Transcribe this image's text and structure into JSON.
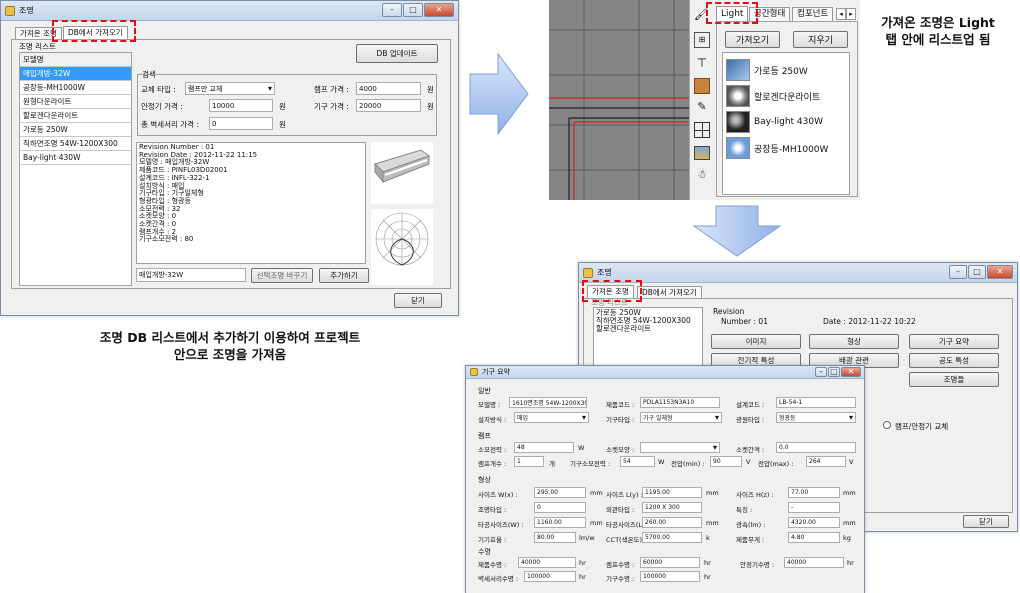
{
  "win1": {
    "title": "조명",
    "tabs": [
      "가져온 조명",
      "DB에서 가져오기"
    ],
    "group_label": "조명 리스트",
    "db_update": "DB 업데이트",
    "list_header": "모델명",
    "list_items": [
      "매입개방-32W",
      "공장등-MH1000W",
      "원형다운라이트",
      "할로겐다운라이트",
      "가로등 250W",
      "직하면조명 54W-1200X300",
      "Bay-light 430W"
    ],
    "search_group": "검색",
    "f_type_label": "교체 타입 :",
    "f_type_value": "램프만 교체",
    "f_lamp_label": "램프 가격 :",
    "f_lamp_value": "4000",
    "unit_won": "원",
    "f_stable_label": "안정기 가격 :",
    "f_stable_value": "10000",
    "f_fixture_label": "기구 가격 :",
    "f_fixture_value": "20000",
    "f_total_label": "총 벽세서리 가격 :",
    "f_total_value": "0",
    "info_lines": [
      "Revision Number : 01",
      "Revision Date : 2012-11-22 11:15",
      "모델명 : 매입개방-32W",
      "제품코드 : PINFL03D02001",
      "설계코드 : INFL-322-1",
      "설치방식 : 매입",
      "기구타입 : 기구일체형",
      "형광타입 : 형광등",
      "소모전력 : 32",
      "소켓모양 : 0",
      "소켓간격 : 0",
      "램프개수 : 2",
      "기구소모전력 : 80"
    ],
    "name_input": "매입개방-32W",
    "btn_change": "선택조명 바꾸기",
    "btn_add": "추가하기",
    "btn_close": "닫기"
  },
  "win2": {
    "tabs": [
      "Light",
      "공간형태",
      "컴포넌트"
    ],
    "btn_fetch": "가져오기",
    "btn_clear": "지우기",
    "items": [
      "가로등 250W",
      "할로겐다운라이트",
      "Bay-light 430W",
      "공장등-MH1000W"
    ]
  },
  "win3": {
    "title": "조명",
    "tabs": [
      "가져온 조명",
      "DB에서 가져오기"
    ],
    "group_label": "조명 리스트",
    "list_items": [
      "가로등 250W",
      "직하면조명 54W-1200X300",
      "할로겐다운라이트"
    ],
    "revision_label": "Revision",
    "number_text": "Number :  01",
    "date_text": "Date :  2012-11-22 10:22",
    "btns": [
      "이미지",
      "형상",
      "기구 요약",
      "전기적 특성",
      "배광 관련",
      "공도 특성"
    ],
    "btn_light": "조명들",
    "radio_label": "램프/안정기 교체",
    "btn_close": "닫기"
  },
  "win4": {
    "title": "기구 요약",
    "sec_general": "일반",
    "model_label": "모델명 :",
    "model_value": "1610면조명 54W-1200X300",
    "code_label": "제품코드 :",
    "code_value": "PDLA1153N3A10",
    "design_label": "설계코드 :",
    "design_value": "LB-54-1",
    "install_label": "설치방식 :",
    "install_value": "매입",
    "ftype_label": "기구타입 :",
    "ftype_value": "기구 일체형",
    "light_label": "광원타입 :",
    "light_value": "형광등",
    "sec_lamp": "램프",
    "power_label": "소모전력 :",
    "power_value": "48",
    "unit_w": "W",
    "socket_label": "소켓모양 :",
    "socket_value": "",
    "gap_label": "소켓간격 :",
    "gap_value": "0.0",
    "count_label": "램프개수 :",
    "count_value": "1",
    "unit_ea": "개",
    "fpower_label": "기구소모전력 :",
    "fpower_value": "54",
    "vmin_label": "전압(min) :",
    "vmin_value": "90",
    "unit_v": "V",
    "vmax_label": "전압(max) :",
    "vmax_value": "264",
    "sec_shape": "형상",
    "sx_label": "사이즈 W(x) :",
    "sx_value": "295.00",
    "unit_mm": "mm",
    "sy_label": "사이즈 L(y) :",
    "sy_value": "1195.00",
    "sz_label": "사이즈 H(z) :",
    "sz_value": "77.00",
    "shape_label": "조명타입 :",
    "shape_value": "0",
    "outer_label": "외관타입 :",
    "outer_value": "1200 X 300",
    "feat_label": "특징 :",
    "feat_value": "-",
    "hw_label": "타공사이즈(W) :",
    "hw_value": "1160.00",
    "hl_label": "타공사이즈(L) :",
    "hl_value": "260.00",
    "beam_label": "광속(lm) :",
    "beam_value": "4320.00",
    "eff_label": "기기효율 :",
    "eff_value": "80.00",
    "unit_eff": "lm/w",
    "cct_label": "CCT(색온도) :",
    "cct_value": "5700.00",
    "unit_k": "k",
    "weight_label": "제품무게 :",
    "weight_value": "4.80",
    "unit_kg": "kg",
    "sec_life": "수명",
    "life_label": "제품수명 :",
    "life_value": "40000",
    "unit_hr": "hr",
    "llife_label": "램프수명 :",
    "llife_value": "60000",
    "slife_label": "안정기수명 :",
    "slife_value": "40000",
    "alife_label": "벽세서리수명 :",
    "alife_value": "100000",
    "flife_label": "기구수명 :",
    "flife_value": "100000"
  },
  "notes": {
    "left": [
      "조명 DB 리스트에서 추가하기 이용하여 프로젝트",
      "안으로 조명을 가져옴"
    ],
    "right": [
      "가져온 조명은 Light",
      "탭 안에 리스트업 됨"
    ]
  },
  "colors": {
    "arrow": "#8fb1e5",
    "highlight": "#e01010",
    "selected": "#3399ff"
  }
}
